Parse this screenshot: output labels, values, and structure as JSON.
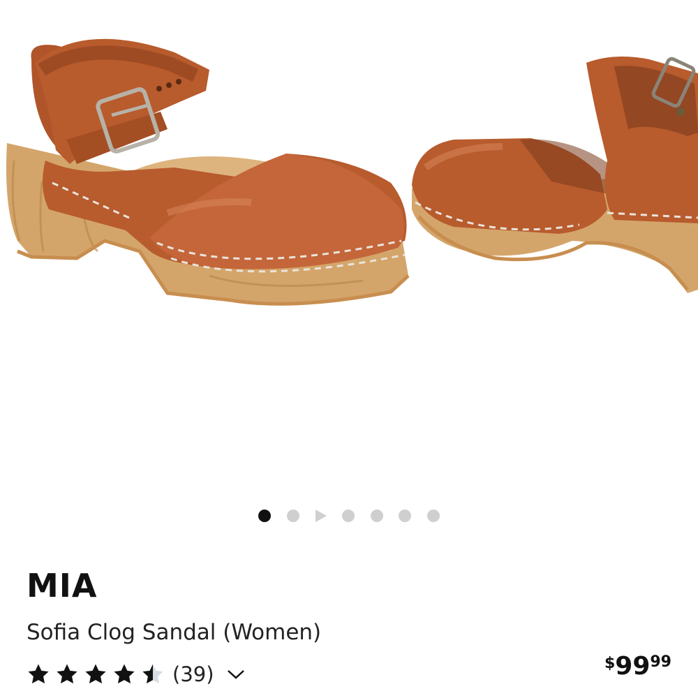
{
  "gallery": {
    "image_subject": "product-photo",
    "dots": [
      {
        "type": "image",
        "active": true
      },
      {
        "type": "image",
        "active": false
      },
      {
        "type": "video",
        "active": false
      },
      {
        "type": "image",
        "active": false
      },
      {
        "type": "image",
        "active": false
      },
      {
        "type": "image",
        "active": false
      },
      {
        "type": "image",
        "active": false
      }
    ]
  },
  "product": {
    "brand": "MIA",
    "name": "Sofia Clog Sandal (Women)",
    "rating": 4.5,
    "rating_max": 5,
    "review_count": "(39)",
    "price": {
      "symbol": "$",
      "dollars": "99",
      "cents": "99"
    }
  },
  "colors": {
    "leather": "#B85B2D",
    "wood": "#D4A56A",
    "text": "#111111",
    "dot_inactive": "#CFCFCF"
  },
  "icons": {
    "rating_star": "star-icon",
    "expand_reviews": "chevron-down-icon",
    "video_dot": "play-icon"
  }
}
